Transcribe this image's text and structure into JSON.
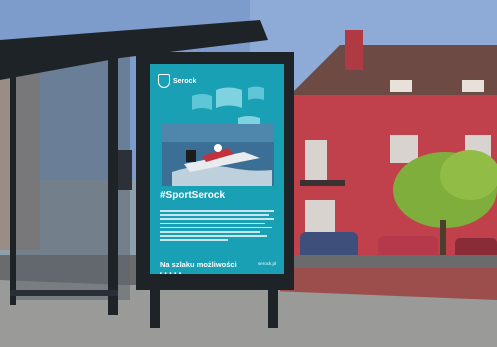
{
  "poster": {
    "brand": "Serock",
    "hashtag": "#SportSerock",
    "tagline": "Na szlaku możliwości",
    "website": "serock.pl",
    "partner_logos": "■ ■ ■ ■ ■"
  },
  "colors": {
    "poster_teal": "#1aa0b4",
    "sky": "#6f93c4",
    "building_red": "#c0404c",
    "tree_green": "#7fae3c",
    "shelter_dark": "#1e2328"
  }
}
